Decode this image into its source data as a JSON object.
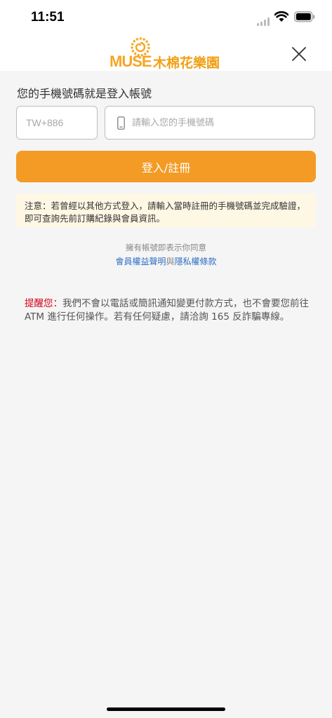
{
  "status_bar": {
    "time": "11:51",
    "icons": [
      "signal-icon",
      "wifi-icon",
      "battery-icon"
    ]
  },
  "header": {
    "logo_latin": "MUSE",
    "logo_cjk": "木棉花樂園",
    "close_icon": "close-icon"
  },
  "login": {
    "title": "您的手機號碼就是登入帳號",
    "country_code": "TW+886",
    "phone_placeholder": "請輸入您的手機號碼",
    "phone_value": "",
    "submit_label": "登入/註冊"
  },
  "notice": {
    "text": "注意：若曾經以其他方式登入，請輸入當時註冊的手機號碼並完成驗證，即可查詢先前訂購紀錄與會員資訊。"
  },
  "terms": {
    "intro": "擁有帳號即表示你同意",
    "link1": "會員權益聲明",
    "joiner": "與",
    "link2": "隱私權條款"
  },
  "warning": {
    "label": "提醒您：",
    "text": "我們不會以電話或簡訊通知變更付款方式，也不會要您前往 ATM 進行任何操作。若有任何疑慮，請洽詢 165 反詐騙專線。"
  },
  "colors": {
    "accent": "#f39b25",
    "notice_bg": "#fdf7e4",
    "link": "#2f6fc4",
    "warning_label": "#d0021b",
    "background": "#f5f5f5"
  }
}
